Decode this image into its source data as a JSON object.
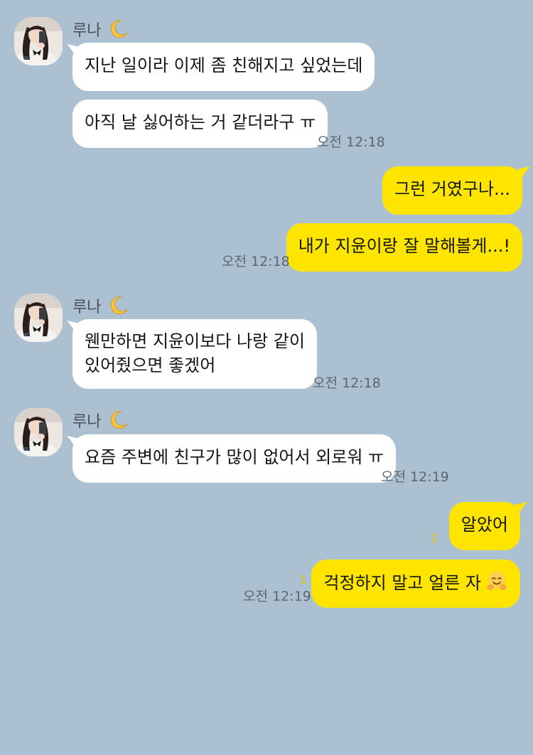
{
  "colors": {
    "background": "#abc1d1",
    "bubble_incoming": "#ffffff",
    "bubble_outgoing": "#fee500",
    "unread": "#e4c200"
  },
  "messages": {
    "g1": {
      "sender": "루나",
      "m1": "지난 일이라 이제 좀 친해지고 싶었는데",
      "m2": "아직 날 싫어하는 거 같더라구 ㅠ",
      "time": "오전 12:18"
    },
    "g2": {
      "m1": "그런 거였구나...",
      "m2": "내가 지윤이랑 잘 말해볼게...!",
      "time": "오전 12:18"
    },
    "g3": {
      "sender": "루나",
      "m1_line1": "웬만하면 지윤이보다 나랑 같이",
      "m1_line2": "있어줬으면 좋겠어",
      "time": "오전 12:18"
    },
    "g4": {
      "sender": "루나",
      "m1": "요즘 주변에 친구가 많이 없어서 외로워 ㅠ",
      "time": "오전 12:19"
    },
    "g5": {
      "m1": "알았어",
      "m1_unread": "1",
      "m2": "걱정하지 말고 얼른 자",
      "m2_emoji": "hugging-face-emoji",
      "m2_unread": "1",
      "time": "오전 12:19"
    }
  },
  "icons": {
    "profile": "profile-photo-avatar",
    "moon": "crescent-moon-emoji"
  }
}
